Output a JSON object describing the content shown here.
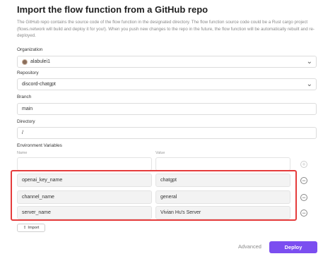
{
  "dialog": {
    "title": "Import the flow function from a GitHub repo",
    "description": "The GitHub repo contains the source code of the flow function in the designated directory. The flow function source code could be a Rust cargo project (flows.network will build and deploy it for you!). When you push new changes to the repo in the future, the flow function will be automatically rebuilt and re-deployed."
  },
  "organization": {
    "label": "Organization",
    "value": "alabulei1"
  },
  "repository": {
    "label": "Repository",
    "value": "discord-chatgpt"
  },
  "branch": {
    "label": "Branch",
    "value": "main"
  },
  "directory": {
    "label": "Directory",
    "value": "/"
  },
  "env": {
    "label": "Environment Variables",
    "name_header": "Name",
    "value_header": "Value",
    "rows": [
      {
        "name": "openai_key_name",
        "value": "chatgpt"
      },
      {
        "name": "channel_name",
        "value": "general"
      },
      {
        "name": "server_name",
        "value": "Vivian Hu's Server"
      }
    ],
    "import_label": "Import"
  },
  "footer": {
    "advanced_label": "Advanced",
    "deploy_label": "Deploy"
  },
  "colors": {
    "accent": "#7b4ef0",
    "highlight": "#e53c3c"
  },
  "icons": {
    "dropdown": "chevron-down-icon",
    "add": "plus-circle-icon",
    "remove": "minus-circle-icon",
    "import": "upload-icon"
  }
}
